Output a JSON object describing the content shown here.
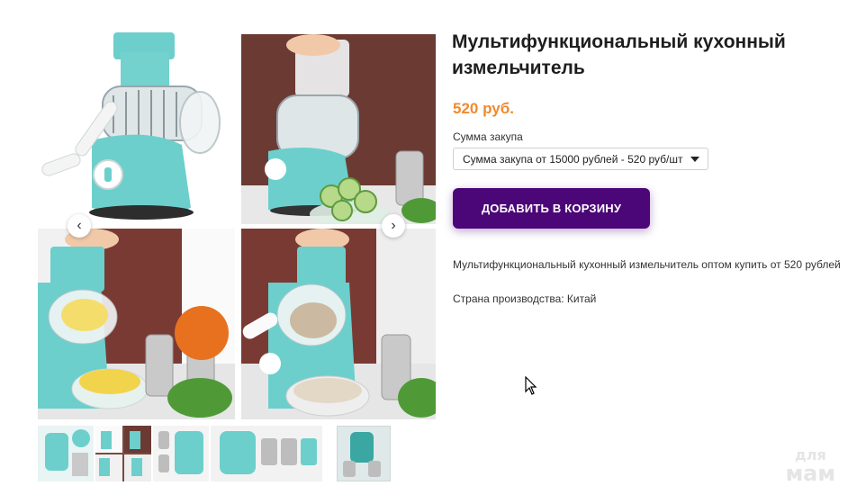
{
  "product": {
    "title": "Мультифункциональный кухонный измельчитель",
    "price": "520 руб.",
    "option_label": "Сумма закупа",
    "option_selected": "Сумма закупа от 15000 рублей - 520 руб/шт",
    "add_to_cart": "ДОБАВИТЬ В КОРЗИНУ",
    "description": "Мультифункциональный кухонный измельчитель оптом купить от 520 рублей",
    "country": "Страна производства: Китай"
  },
  "gallery": {
    "prev_icon": "‹",
    "next_icon": "›"
  },
  "watermark": {
    "line1": "для",
    "line2": "мам"
  },
  "colors": {
    "price": "#f08a2c",
    "button": "#4b0677",
    "product_teal": "#62c6c4"
  }
}
